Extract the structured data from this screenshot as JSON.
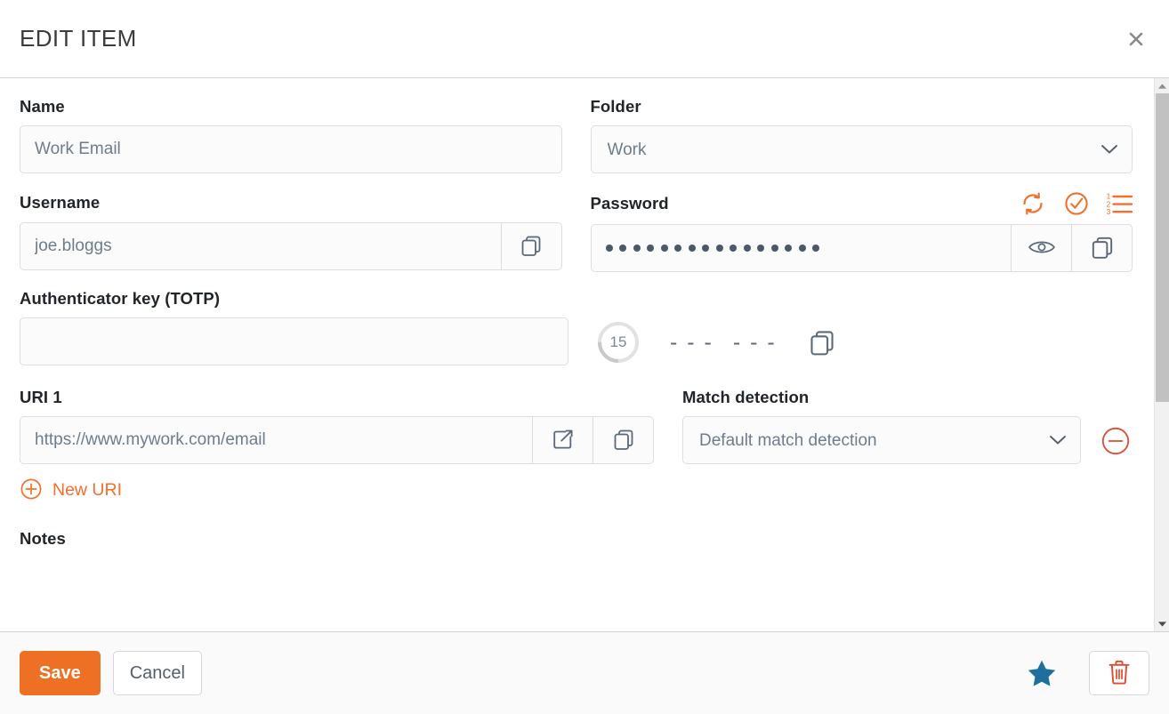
{
  "header": {
    "title": "EDIT ITEM",
    "close_icon": "close-icon"
  },
  "fields": {
    "name": {
      "label": "Name",
      "value": "Work Email",
      "placeholder": "Name"
    },
    "folder": {
      "label": "Folder",
      "value": "Work",
      "options": [
        "Work"
      ],
      "chevron_icon": "chevron-down-icon"
    },
    "username": {
      "label": "Username",
      "value": "joe.bloggs",
      "placeholder": "Username",
      "copy_icon": "copy-icon"
    },
    "password": {
      "label": "Password",
      "masked_value": "••••••••••••••••",
      "dot_count": 16,
      "toggle_icon": "eye-icon",
      "copy_icon": "copy-icon",
      "actions": [
        {
          "name": "generate-password",
          "icon": "refresh-icon"
        },
        {
          "name": "check-password",
          "icon": "check-circle-icon"
        },
        {
          "name": "password-history",
          "icon": "numbered-list-icon"
        }
      ]
    },
    "totp": {
      "label": "Authenticator key (TOTP)",
      "value": "",
      "placeholder": "",
      "countdown": "15",
      "code": [
        "- - -",
        "- - -"
      ],
      "copy_icon": "copy-icon"
    },
    "uri": {
      "label": "URI 1",
      "value": "https://www.mywork.com/email",
      "placeholder": "URI",
      "launch_icon": "external-link-icon",
      "copy_icon": "copy-icon",
      "new_uri_label": "New URI",
      "new_uri_icon": "plus-circle-icon",
      "remove_icon": "minus-circle-icon"
    },
    "match_detection": {
      "label": "Match detection",
      "value": "Default match detection",
      "options": [
        "Default match detection"
      ],
      "chevron_icon": "chevron-down-icon"
    },
    "notes": {
      "label": "Notes"
    }
  },
  "footer": {
    "save_label": "Save",
    "cancel_label": "Cancel",
    "favorite_icon": "star-icon",
    "delete_icon": "trash-icon"
  },
  "scrollbar": {
    "up_icon": "triangle-up-icon",
    "down_icon": "triangle-down-icon"
  },
  "colors": {
    "accent_orange": "#ed7024",
    "link_orange": "#f2702c",
    "danger_red": "#e04b33",
    "favorite_blue": "#1f6f9c",
    "text_dark": "#212529",
    "text_muted": "#6e7d8c",
    "border": "#dcdee2"
  }
}
